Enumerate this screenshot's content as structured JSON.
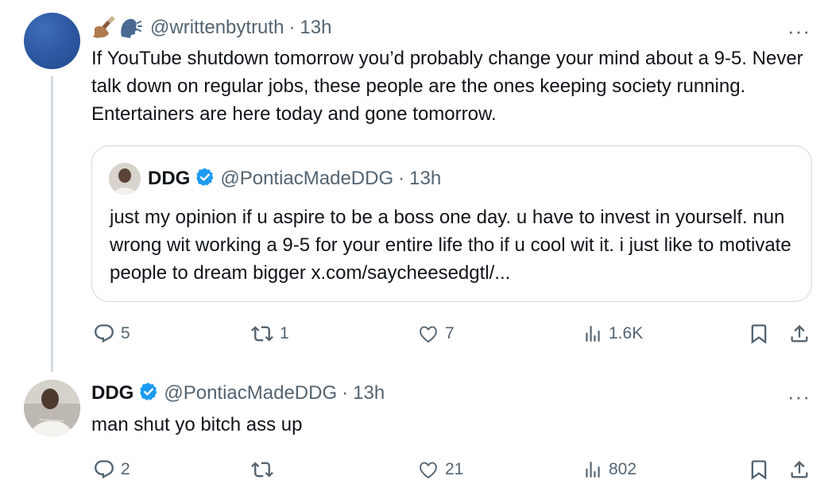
{
  "tweet1": {
    "handle": "@writtenbytruth",
    "time": "13h",
    "text": "If YouTube shutdown tomorrow you’d probably change your mind about a 9-5. Never talk down on regular jobs, these people are the ones keeping society running. Entertainers are here today and gone tomorrow.",
    "more": "···",
    "quote": {
      "name": "DDG",
      "handle": "@PontiacMadeDDG",
      "time": "13h",
      "text": "just my opinion if u aspire to be a boss one day. u have to invest in yourself. nun wrong wit working a 9-5 for your entire life tho if u cool wit it. i just like to motivate people to dream bigger x.com/saycheesedgtl/..."
    },
    "stats": {
      "replies": "5",
      "reposts": "1",
      "likes": "7",
      "views": "1.6K"
    }
  },
  "tweet2": {
    "name": "DDG",
    "handle": "@PontiacMadeDDG",
    "time": "13h",
    "text": "man shut yo bitch ass up",
    "more": "···",
    "stats": {
      "replies": "2",
      "reposts": "",
      "likes": "21",
      "views": "802"
    }
  },
  "separator": "·",
  "colors": {
    "text": "#0f1419",
    "secondary": "#536471",
    "verified": "#1d9bf0",
    "border": "#cfd9de"
  }
}
